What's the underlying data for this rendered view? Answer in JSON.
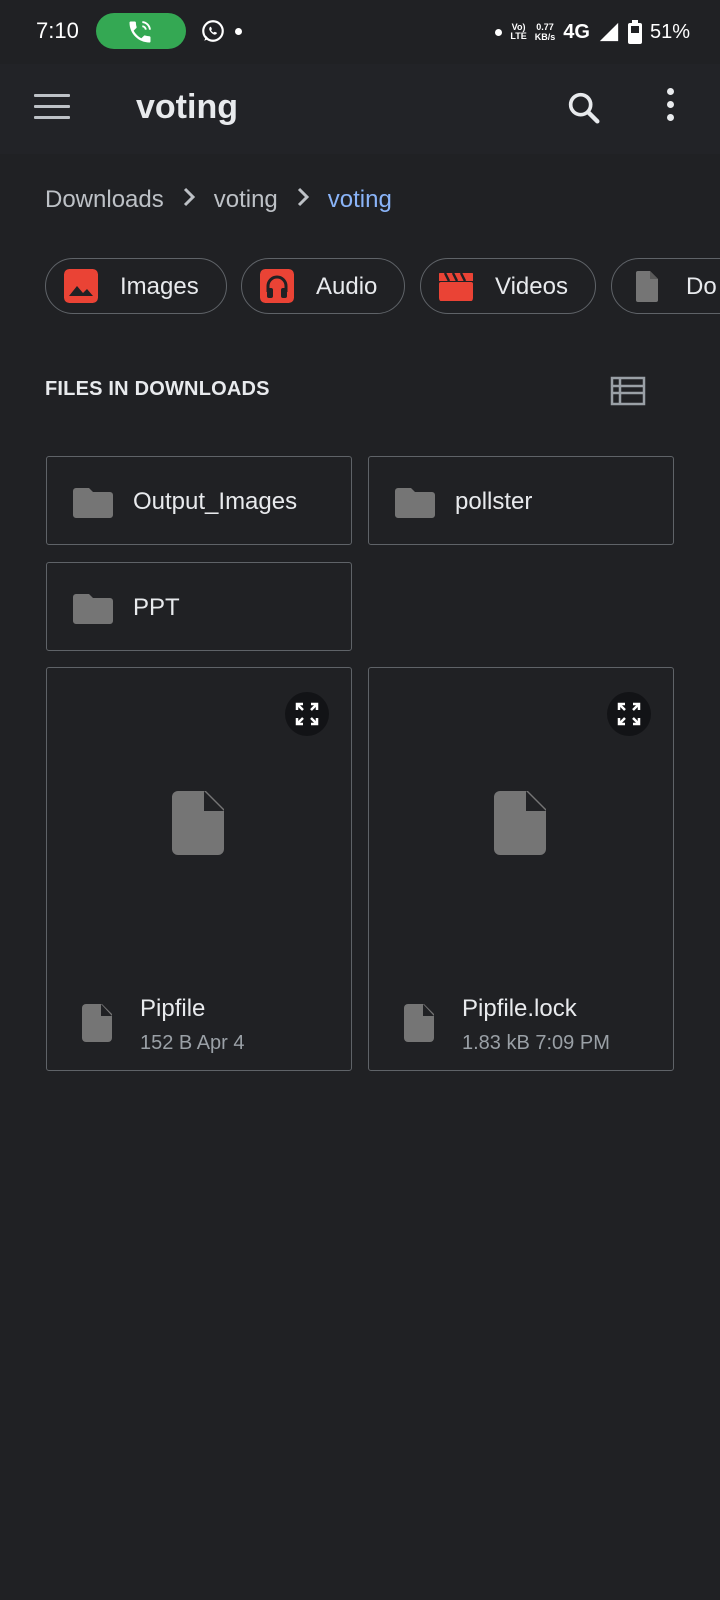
{
  "status_bar": {
    "time": "7:10",
    "volte_line1": "Vo)",
    "volte_line2": "LTE",
    "speed_value": "0.77",
    "speed_unit": "KB/s",
    "network": "4G",
    "battery": "51%",
    "call_color": "#34a853",
    "icons": [
      "phone-call-icon",
      "whatsapp-icon",
      "signal-icon",
      "battery-icon"
    ]
  },
  "app_bar": {
    "title": "voting",
    "icons": [
      "menu-icon",
      "search-icon",
      "more-vert-icon"
    ]
  },
  "breadcrumb": {
    "items": [
      "Downloads",
      "voting",
      "voting"
    ],
    "active_color": "#8ab4f8"
  },
  "categories": [
    {
      "label": "Images",
      "icon": "image-icon",
      "color": "#ea4335"
    },
    {
      "label": "Audio",
      "icon": "headphones-icon",
      "color": "#ea4335"
    },
    {
      "label": "Videos",
      "icon": "clapperboard-icon",
      "color": "#ea4335"
    },
    {
      "label": "Do",
      "icon": "document-icon",
      "color": "#9aa0a6"
    }
  ],
  "section": {
    "title": "FILES IN DOWNLOADS",
    "view_icon": "list-view-icon"
  },
  "folders": [
    {
      "name": "Output_Images"
    },
    {
      "name": "pollster"
    },
    {
      "name": "PPT"
    }
  ],
  "files": [
    {
      "name": "Pipfile",
      "meta": "152 B  Apr 4"
    },
    {
      "name": "Pipfile.lock",
      "meta": "1.83 kB  7:09 PM"
    }
  ],
  "colors": {
    "background": "#202124",
    "card_border": "#5f6368",
    "icon_grey": "#757575"
  }
}
